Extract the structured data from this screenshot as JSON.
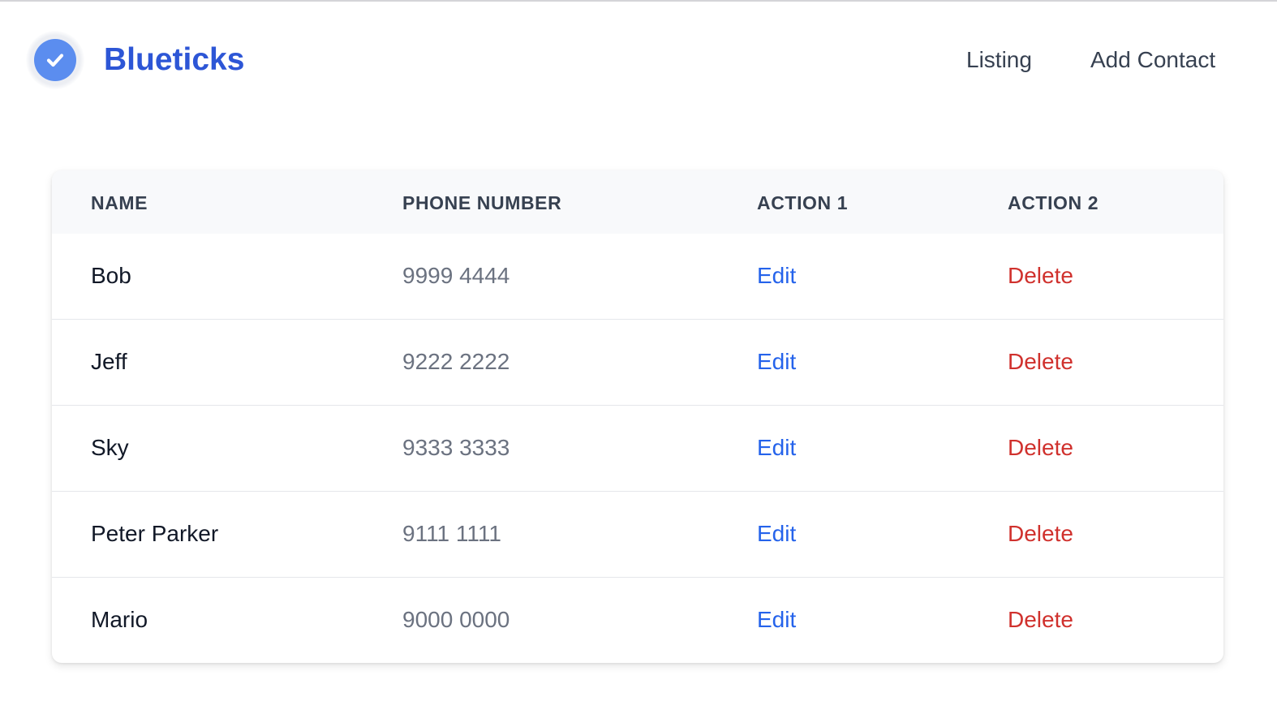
{
  "header": {
    "brand": "Blueticks",
    "logo_icon": "check-circle-icon",
    "nav": {
      "listing": "Listing",
      "add_contact": "Add Contact"
    }
  },
  "table": {
    "columns": [
      "NAME",
      "PHONE NUMBER",
      "ACTION 1",
      "ACTION 2"
    ],
    "rows": [
      {
        "name": "Bob",
        "phone": "9999 4444",
        "action1": "Edit",
        "action2": "Delete"
      },
      {
        "name": "Jeff",
        "phone": "9222 2222",
        "action1": "Edit",
        "action2": "Delete"
      },
      {
        "name": "Sky",
        "phone": "9333 3333",
        "action1": "Edit",
        "action2": "Delete"
      },
      {
        "name": "Peter Parker",
        "phone": "9111 1111",
        "action1": "Edit",
        "action2": "Delete"
      },
      {
        "name": "Mario",
        "phone": "9000 0000",
        "action1": "Edit",
        "action2": "Delete"
      }
    ]
  },
  "colors": {
    "brand": "#2d56d6",
    "edit": "#2563eb",
    "delete": "#d0312d"
  }
}
